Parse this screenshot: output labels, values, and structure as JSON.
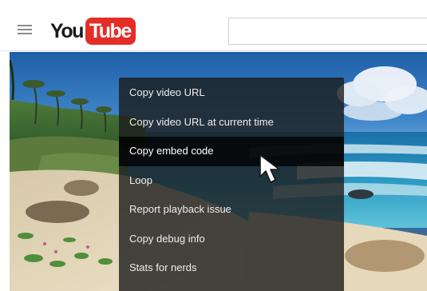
{
  "header": {
    "logo": {
      "you": "You",
      "tube": "Tube"
    },
    "search": {
      "value": "",
      "placeholder": ""
    }
  },
  "context_menu": {
    "items": [
      {
        "label": "Copy video URL"
      },
      {
        "label": "Copy video URL at current time"
      },
      {
        "label": "Copy embed code",
        "hovered": true
      },
      {
        "label": "Loop"
      },
      {
        "label": "Report playback issue"
      },
      {
        "label": "Copy debug info"
      },
      {
        "label": "Stats for nerds"
      }
    ]
  },
  "colors": {
    "brand_red": "#e52d27",
    "menu_bg": "#1c1c1c",
    "menu_text": "#eeeeee"
  },
  "icons": {
    "menu": "hamburger-icon",
    "pointer": "mouse-cursor-icon"
  }
}
